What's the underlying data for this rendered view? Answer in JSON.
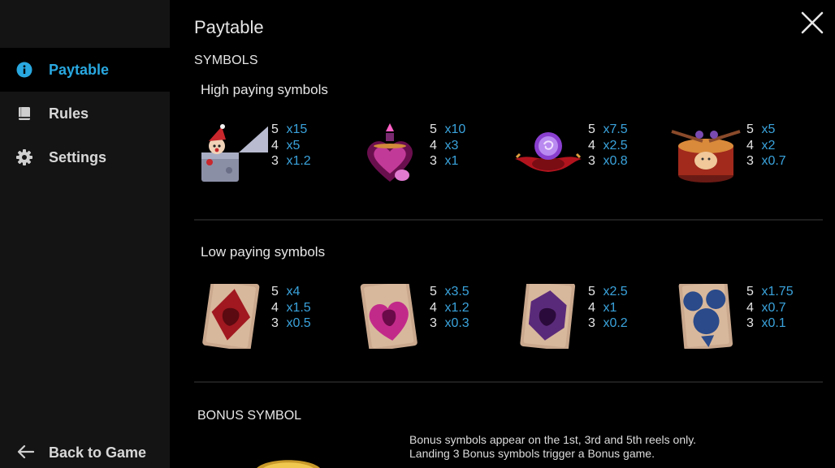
{
  "sidebar": {
    "items": [
      {
        "label": "Paytable",
        "icon": "info-icon",
        "active": true
      },
      {
        "label": "Rules",
        "icon": "book-icon",
        "active": false
      },
      {
        "label": "Settings",
        "icon": "gear-icon",
        "active": false
      }
    ],
    "back_label": "Back to Game",
    "accent": "#29a8e0"
  },
  "main": {
    "title": "Paytable",
    "section_symbols": "SYMBOLS",
    "high_heading": "High paying symbols",
    "low_heading": "Low paying symbols",
    "bonus_heading": "BONUS SYMBOL",
    "bonus_desc_1": "Bonus symbols appear on the 1st, 3rd and 5th reels only.",
    "bonus_desc_2": "Landing 3 Bonus symbols trigger a Bonus game."
  },
  "high_symbols": [
    {
      "name": "jack-in-the-box",
      "pays": [
        {
          "count": "5",
          "mult": "x15"
        },
        {
          "count": "4",
          "mult": "x5"
        },
        {
          "count": "3",
          "mult": "x1.2"
        }
      ]
    },
    {
      "name": "heart-potion",
      "pays": [
        {
          "count": "5",
          "mult": "x10"
        },
        {
          "count": "4",
          "mult": "x3"
        },
        {
          "count": "3",
          "mult": "x1"
        }
      ]
    },
    {
      "name": "crystal-ball",
      "pays": [
        {
          "count": "5",
          "mult": "x7.5"
        },
        {
          "count": "4",
          "mult": "x2.5"
        },
        {
          "count": "3",
          "mult": "x0.8"
        }
      ]
    },
    {
      "name": "drum",
      "pays": [
        {
          "count": "5",
          "mult": "x5"
        },
        {
          "count": "4",
          "mult": "x2"
        },
        {
          "count": "3",
          "mult": "x0.7"
        }
      ]
    }
  ],
  "low_symbols": [
    {
      "name": "red-card",
      "pays": [
        {
          "count": "5",
          "mult": "x4"
        },
        {
          "count": "4",
          "mult": "x1.5"
        },
        {
          "count": "3",
          "mult": "x0.5"
        }
      ]
    },
    {
      "name": "pink-card",
      "pays": [
        {
          "count": "5",
          "mult": "x3.5"
        },
        {
          "count": "4",
          "mult": "x1.2"
        },
        {
          "count": "3",
          "mult": "x0.3"
        }
      ]
    },
    {
      "name": "purple-card",
      "pays": [
        {
          "count": "5",
          "mult": "x2.5"
        },
        {
          "count": "4",
          "mult": "x1"
        },
        {
          "count": "3",
          "mult": "x0.2"
        }
      ]
    },
    {
      "name": "blue-card",
      "pays": [
        {
          "count": "5",
          "mult": "x1.75"
        },
        {
          "count": "4",
          "mult": "x0.7"
        },
        {
          "count": "3",
          "mult": "x0.1"
        }
      ]
    }
  ]
}
